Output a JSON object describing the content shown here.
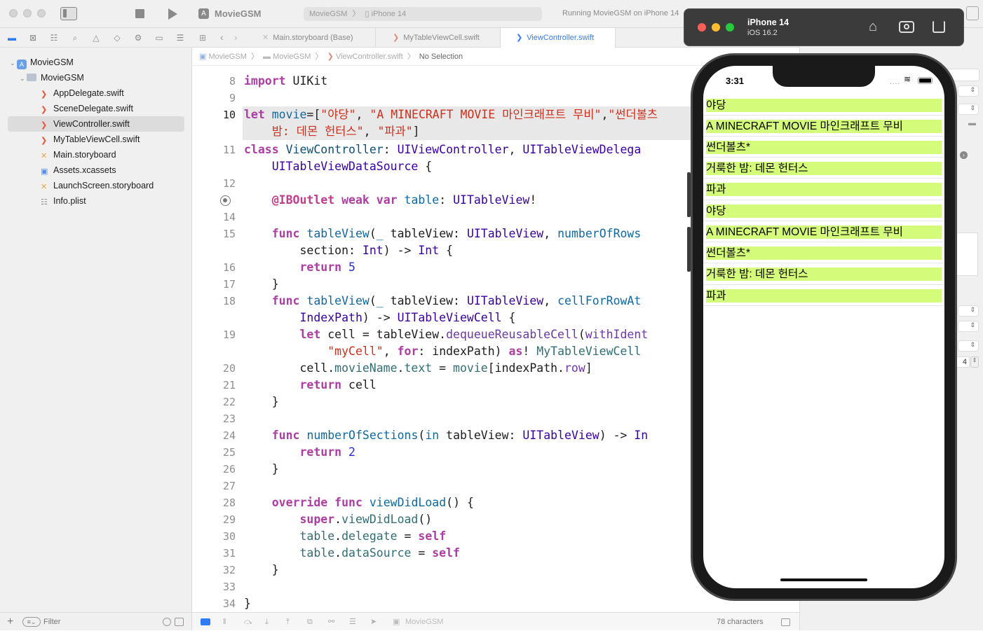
{
  "toolbar": {
    "project_name": "MovieGSM",
    "scheme": "MovieGSM",
    "destination": "iPhone 14",
    "status": "Running MovieGSM on iPhone 14"
  },
  "tabs": [
    {
      "label": "Main.storyboard (Base)"
    },
    {
      "label": "MyTableViewCell.swift"
    },
    {
      "label": "ViewController.swift"
    }
  ],
  "jumpbar": {
    "items": [
      "MovieGSM",
      "MovieGSM",
      "ViewController.swift",
      "No Selection"
    ]
  },
  "navigator": {
    "items": [
      {
        "label": "MovieGSM"
      },
      {
        "label": "MovieGSM"
      },
      {
        "label": "AppDelegate.swift"
      },
      {
        "label": "SceneDelegate.swift"
      },
      {
        "label": "ViewController.swift"
      },
      {
        "label": "MyTableViewCell.swift"
      },
      {
        "label": "Main.storyboard"
      },
      {
        "label": "Assets.xcassets"
      },
      {
        "label": "LaunchScreen.storyboard"
      },
      {
        "label": "Info.plist"
      }
    ],
    "filter_placeholder": "Filter"
  },
  "editor": {
    "line_numbers": [
      "8",
      "9",
      "10",
      "11",
      "12",
      "",
      "14",
      "15",
      "16",
      "17",
      "18",
      "19",
      "20",
      "21",
      "22",
      "23",
      "24",
      "25",
      "26",
      "27",
      "28",
      "29",
      "30",
      "31",
      "32",
      "33",
      "34"
    ],
    "code": {
      "l8": [
        "import",
        " UIKit"
      ],
      "l10a": [
        "let",
        " movie",
        "=[",
        "\"야당\"",
        ", ",
        "\"A MINECRAFT MOVIE 마인크래프트 무비\"",
        ",",
        "\"썬더볼츠"
      ],
      "l10b": [
        "    밤: 데몬 헌터스\"",
        ", ",
        "\"파과\"",
        "]"
      ],
      "l11a": [
        "class",
        " ",
        "ViewController",
        ": ",
        "UIViewController",
        ", ",
        "UITableViewDelega"
      ],
      "l11b": [
        "    ",
        "UITableViewDataSource",
        " {"
      ],
      "l13": [
        "    ",
        "@IBOutlet",
        " ",
        "weak",
        " ",
        "var",
        " ",
        "table",
        ": ",
        "UITableView",
        "!"
      ],
      "l15a": [
        "    ",
        "func",
        " ",
        "tableView",
        "(",
        "_",
        " tableView: ",
        "UITableView",
        ", ",
        "numberOfRows"
      ],
      "l15b": [
        "        section: ",
        "Int",
        ") -> ",
        "Int",
        " {"
      ],
      "l16": [
        "        ",
        "return",
        " ",
        "5"
      ],
      "l17": [
        "    }"
      ],
      "l18a": [
        "    ",
        "func",
        " ",
        "tableView",
        "(",
        "_",
        " tableView: ",
        "UITableView",
        ", ",
        "cellForRowAt"
      ],
      "l18b": [
        "        ",
        "IndexPath",
        ") -> ",
        "UITableViewCell",
        " {"
      ],
      "l19a": [
        "        ",
        "let",
        " cell = tableView.",
        "dequeueReusableCell",
        "(",
        "withIdent"
      ],
      "l19b": [
        "            ",
        "\"myCell\"",
        ", ",
        "for",
        ": indexPath) ",
        "as",
        "! ",
        "MyTableViewCell"
      ],
      "l20": [
        "        cell.",
        "movieName",
        ".",
        "text",
        " = ",
        "movie",
        "[indexPath.",
        "row",
        "]"
      ],
      "l21": [
        "        ",
        "return",
        " cell"
      ],
      "l22": [
        "    }"
      ],
      "l24": [
        "    ",
        "func",
        " ",
        "numberOfSections",
        "(",
        "in",
        " tableView: ",
        "UITableView",
        ") -> ",
        "In"
      ],
      "l25": [
        "        ",
        "return",
        " ",
        "2"
      ],
      "l26": [
        "    }"
      ],
      "l28": [
        "    ",
        "override",
        " ",
        "func",
        " ",
        "viewDidLoad",
        "() {"
      ],
      "l29": [
        "        ",
        "super",
        ".",
        "viewDidLoad",
        "()"
      ],
      "l30": [
        "        ",
        "table",
        ".",
        "delegate",
        " = ",
        "self"
      ],
      "l31": [
        "        ",
        "table",
        ".",
        "dataSource",
        " = ",
        "self"
      ],
      "l32": [
        "    }"
      ],
      "l34": [
        "}"
      ]
    }
  },
  "statusbar": {
    "scheme": "MovieGSM",
    "char_count": "78 characters"
  },
  "inspector": {
    "stepper_value": "4"
  },
  "simulator": {
    "device": "iPhone 14",
    "os": "iOS 16.2",
    "time": "3:31",
    "rows": [
      "야당",
      "A MINECRAFT MOVIE 마인크래프트 무비",
      "썬더볼츠*",
      "거룩한 밤: 데몬 헌터스",
      "파과",
      "야당",
      "A MINECRAFT MOVIE 마인크래프트 무비",
      "썬더볼츠*",
      "거룩한 밤: 데몬 헌터스",
      "파과"
    ]
  },
  "colors": {
    "cell_bg": "#d4fb79",
    "accent": "#2f7cf6"
  }
}
